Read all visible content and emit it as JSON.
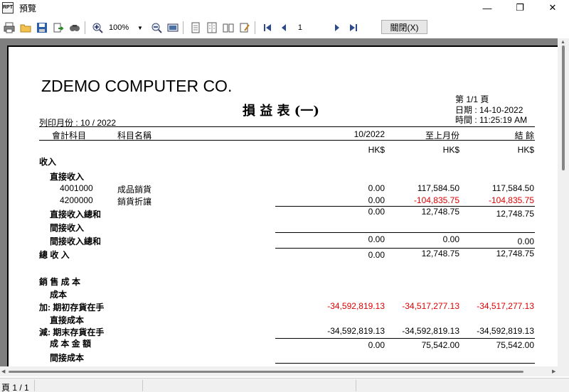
{
  "window": {
    "title": "預覽",
    "app_icon": "report-app-icon"
  },
  "toolbar": {
    "zoom": "100%",
    "page_input": "1",
    "close_label": "關閉(X)",
    "icons": [
      "print-icon",
      "open-folder-icon",
      "save-icon",
      "export-icon",
      "find-icon",
      "zoom-in-icon",
      "zoom-out-icon",
      "fit-page-icon",
      "single-page-icon",
      "multi-page-icon",
      "book-icon",
      "edit-icon",
      "first-page-icon",
      "prev-page-icon",
      "next-page-icon",
      "last-page-icon"
    ]
  },
  "report": {
    "company": "ZDEMO COMPUTER CO.",
    "title": "損 益 表 (一)",
    "page_info": "第 1/1 頁",
    "date": "日期 : 14-10-2022",
    "time": "時間 : 11:25:19 AM",
    "print_month": "列印月份 : 10 / 2022",
    "headers": {
      "account_code": "會計科目",
      "account_name": "科目名稱",
      "col1": "10/2022",
      "col2": "至上月份",
      "col3": "結  餘"
    },
    "currency": "HK$",
    "rows": {
      "income": "收入",
      "direct_income": "直接收入",
      "acc1_code": "4001000",
      "acc1_name": "成品銷貨",
      "acc1_v1": "0.00",
      "acc1_v2": "117,584.50",
      "acc1_v3": "117,584.50",
      "acc2_code": "4200000",
      "acc2_name": "銷貨折讓",
      "acc2_v1": "0.00",
      "acc2_v2": "-104,835.75",
      "acc2_v3": "-104,835.75",
      "direct_income_total": "直接收入總和",
      "dit_v1": "0.00",
      "dit_v2": "12,748.75",
      "dit_v3": "12,748.75",
      "indirect_income": "間接收入",
      "indirect_income_total": "間接收入總和",
      "iit_v1": "0.00",
      "iit_v2": "0.00",
      "iit_v3": "0.00",
      "total_income": "總 收 入",
      "ti_v1": "0.00",
      "ti_v2": "12,748.75",
      "ti_v3": "12,748.75",
      "cost_of_sales": "銷 售 成 本",
      "cost": "成本",
      "opening_stock": "加:  期初存貨在手",
      "os_v1": "-34,592,819.13",
      "os_v2": "-34,517,277.13",
      "os_v3": "-34,517,277.13",
      "direct_cost": "直接成本",
      "closing_stock": "減:  期末存貨在手",
      "cs_v1": "-34,592,819.13",
      "cs_v2": "-34,592,819.13",
      "cs_v3": "-34,592,819.13",
      "cost_amount": "成 本 金 額",
      "ca_v1": "0.00",
      "ca_v2": "75,542.00",
      "ca_v3": "75,542.00",
      "indirect_cost": "間接成本"
    }
  },
  "status": {
    "page": "頁 1 / 1"
  }
}
